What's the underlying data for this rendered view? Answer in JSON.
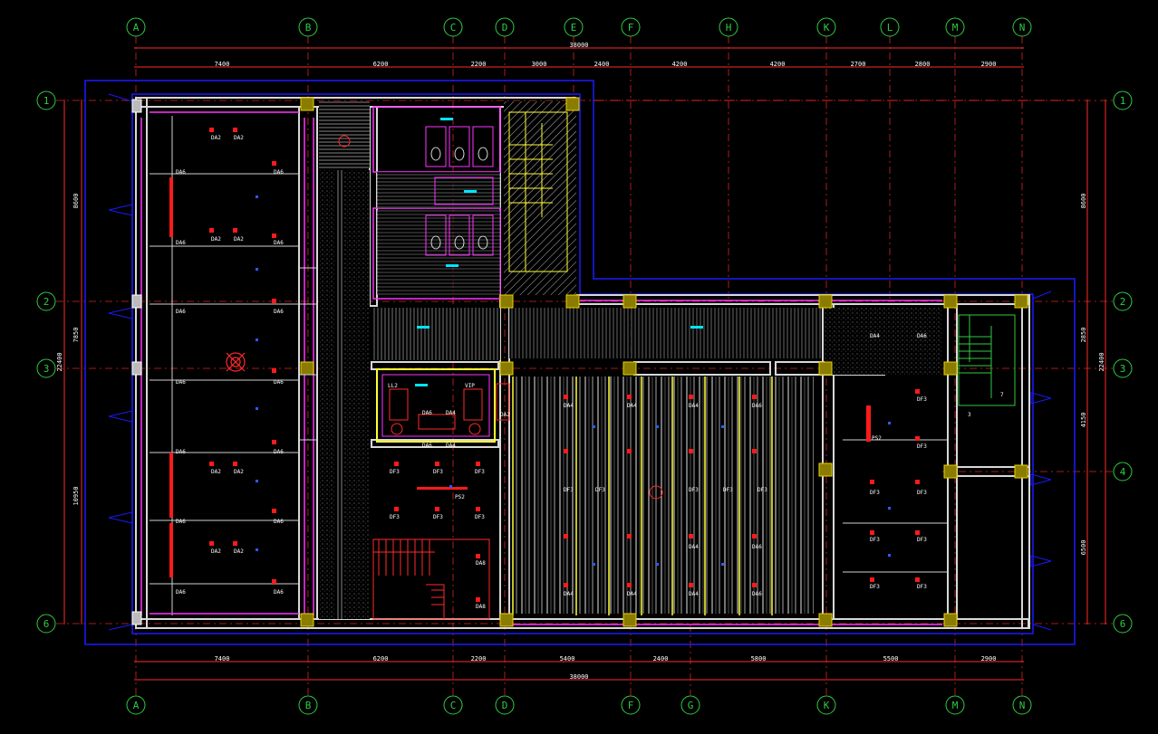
{
  "grid": {
    "top_labels": [
      "A",
      "B",
      "C",
      "D",
      "E",
      "F",
      "H",
      "K",
      "L",
      "M",
      "N"
    ],
    "bottom_labels": [
      "A",
      "B",
      "C",
      "D",
      "F",
      "G",
      "K",
      "M",
      "N"
    ],
    "row_labels": [
      "1",
      "2",
      "3",
      "4",
      "6"
    ]
  },
  "dimensions": {
    "top_total": "38000",
    "top_segments": [
      "7400",
      "6200",
      "2200",
      "3000",
      "2400",
      "4200",
      "4200",
      "2700",
      "2800",
      "2900"
    ],
    "bottom_total": "38000",
    "bottom_segments": [
      "7400",
      "6200",
      "2200",
      "5400",
      "2400",
      "5800",
      "5500",
      "2900"
    ],
    "left_segments": [
      "8600",
      "7850",
      "10950"
    ],
    "left_total": "22400",
    "right_segments": [
      "8600",
      "2850",
      "4150",
      "6500"
    ],
    "right_total": "22400"
  },
  "tags": {
    "da2": "DA2",
    "da6": "DA6",
    "da4": "DA4",
    "df3": "DF3",
    "da8": "DA8",
    "ps2": "PS2",
    "ll2": "LL2",
    "vip": "VIP",
    "num7": "7",
    "num3": "3"
  },
  "colors": {
    "background": "#000000",
    "grid_bubble": "#2ecc40",
    "dimension": "#ff2a2a",
    "outline": "#1a1aff",
    "wall": "#d8d8d8",
    "column": "#c8b400",
    "accent_magenta": "#ff33ff",
    "accent_yellow": "#ffff33",
    "fixture_red": "#ff1a1a",
    "text_white": "#ffffff"
  }
}
